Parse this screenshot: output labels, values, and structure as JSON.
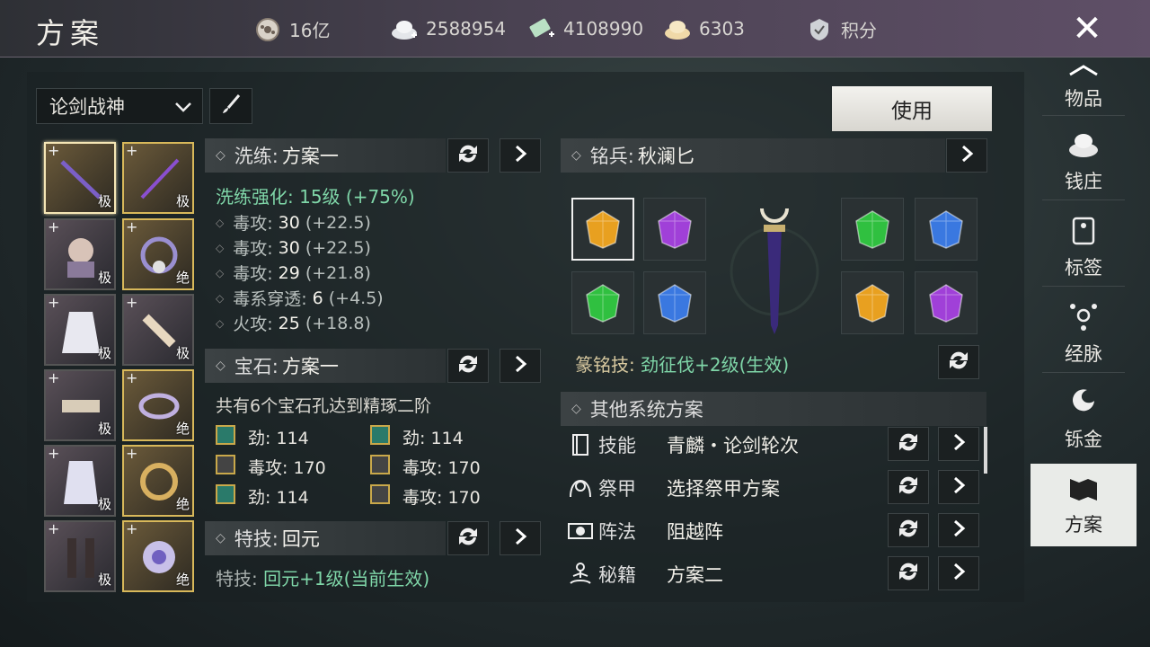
{
  "header": {
    "title": "方案",
    "close_label": "✕"
  },
  "currencies": [
    {
      "icon": "coin-icon",
      "value": "16亿"
    },
    {
      "icon": "silver-icon",
      "value": "2588954"
    },
    {
      "icon": "jade-icon",
      "value": "4108990"
    },
    {
      "icon": "gold-ingot-icon",
      "value": "6303"
    },
    {
      "icon": "points-icon",
      "value": "积分"
    }
  ],
  "toolbar": {
    "scheme_select": "论剑战神",
    "use_label": "使用"
  },
  "equipment": [
    {
      "tier": "极"
    },
    {
      "tier": "极"
    },
    {
      "tier": "极"
    },
    {
      "tier": "绝"
    },
    {
      "tier": "极"
    },
    {
      "tier": "极"
    },
    {
      "tier": "极"
    },
    {
      "tier": "绝"
    },
    {
      "tier": "极"
    },
    {
      "tier": "绝"
    },
    {
      "tier": "极"
    },
    {
      "tier": "绝"
    }
  ],
  "refine": {
    "label": "洗练:",
    "value": "方案一",
    "strength": "洗练强化: 15级 (+75%)",
    "stats": [
      {
        "name": "毒攻:",
        "val": "30",
        "bonus": "(+22.5)"
      },
      {
        "name": "毒攻:",
        "val": "30",
        "bonus": "(+22.5)"
      },
      {
        "name": "毒攻:",
        "val": "29",
        "bonus": "(+21.8)"
      },
      {
        "name": "毒系穿透:",
        "val": "6",
        "bonus": "(+4.5)"
      },
      {
        "name": "火攻:",
        "val": "25",
        "bonus": "(+18.8)"
      }
    ]
  },
  "gems": {
    "label": "宝石:",
    "value": "方案一",
    "summary": "共有6个宝石孔达到精琢二阶",
    "items": [
      {
        "name": "劲:",
        "val": "114"
      },
      {
        "name": "劲:",
        "val": "114"
      },
      {
        "name": "毒攻:",
        "val": "170"
      },
      {
        "name": "毒攻:",
        "val": "170"
      },
      {
        "name": "劲:",
        "val": "114"
      },
      {
        "name": "毒攻:",
        "val": "170"
      }
    ]
  },
  "skill": {
    "label": "特技:",
    "value": "回元",
    "desc_prefix": "特技:",
    "desc": "回元+1级(当前生效)"
  },
  "weapon": {
    "label": "铭兵:",
    "value": "秋澜匕",
    "inscription_prefix": "篆铭技:",
    "inscription": "劲征伐+2级(生效)",
    "gem_colors": [
      "#e8a020",
      "#a040d8",
      "#30c040",
      "#3a78e0",
      "#30c040",
      "#3a78e0",
      "#e8a020",
      "#a040d8"
    ]
  },
  "other": {
    "title": "其他系统方案",
    "rows": [
      {
        "icon": "book-icon",
        "k": "技能",
        "v": "青麟・论剑轮次"
      },
      {
        "icon": "armor-icon",
        "k": "祭甲",
        "v": "选择祭甲方案"
      },
      {
        "icon": "formation-icon",
        "k": "阵法",
        "v": "阻越阵"
      },
      {
        "icon": "meditation-icon",
        "k": "秘籍",
        "v": "方案二"
      }
    ]
  },
  "sidebar": [
    {
      "label": "物品",
      "icon": "items-icon"
    },
    {
      "label": "钱庄",
      "icon": "bank-icon"
    },
    {
      "label": "标签",
      "icon": "tag-icon"
    },
    {
      "label": "经脉",
      "icon": "meridian-icon"
    },
    {
      "label": "铄金",
      "icon": "smelt-icon"
    },
    {
      "label": "方案",
      "icon": "scheme-icon"
    }
  ]
}
